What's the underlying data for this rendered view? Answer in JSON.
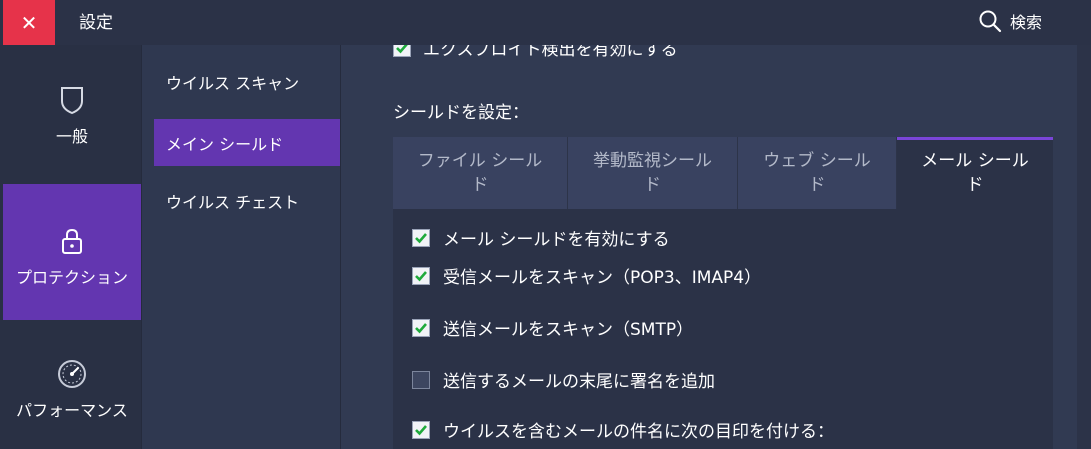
{
  "window": {
    "close_label": "✕",
    "title": "設定",
    "search_label": "検索"
  },
  "rail": {
    "items": [
      {
        "label": "一般",
        "icon": "shield-icon"
      },
      {
        "label": "プロテクション",
        "icon": "lock-icon",
        "active": true
      },
      {
        "label": "パフォーマンス",
        "icon": "gauge-icon"
      }
    ]
  },
  "subnav": {
    "items": [
      {
        "label": "ウイルス スキャン"
      },
      {
        "label": "メイン シールド",
        "active": true
      },
      {
        "label": "ウイルス チェスト"
      }
    ]
  },
  "main": {
    "cut_row_label": "エクスプロイト検出を有効にする",
    "section_label": "シールドを設定：",
    "tabs": [
      {
        "label": "ファイル シールド"
      },
      {
        "label": "挙動監視シールド"
      },
      {
        "label": "ウェブ シールド"
      },
      {
        "label": "メール シールド",
        "active": true
      }
    ],
    "options": [
      {
        "label": "メール シールドを有効にする",
        "checked": true
      },
      {
        "label": "受信メールをスキャン（POP3、IMAP4）",
        "checked": true
      },
      {
        "label": "送信メールをスキャン（SMTP）",
        "checked": true
      },
      {
        "label": "送信するメールの末尾に署名を追加",
        "checked": false
      },
      {
        "label": "ウイルスを含むメールの件名に次の目印を付ける：",
        "checked": true
      }
    ]
  },
  "colors": {
    "accent": "#6336b0",
    "close": "#e6334a",
    "check": "#1faa3c"
  }
}
